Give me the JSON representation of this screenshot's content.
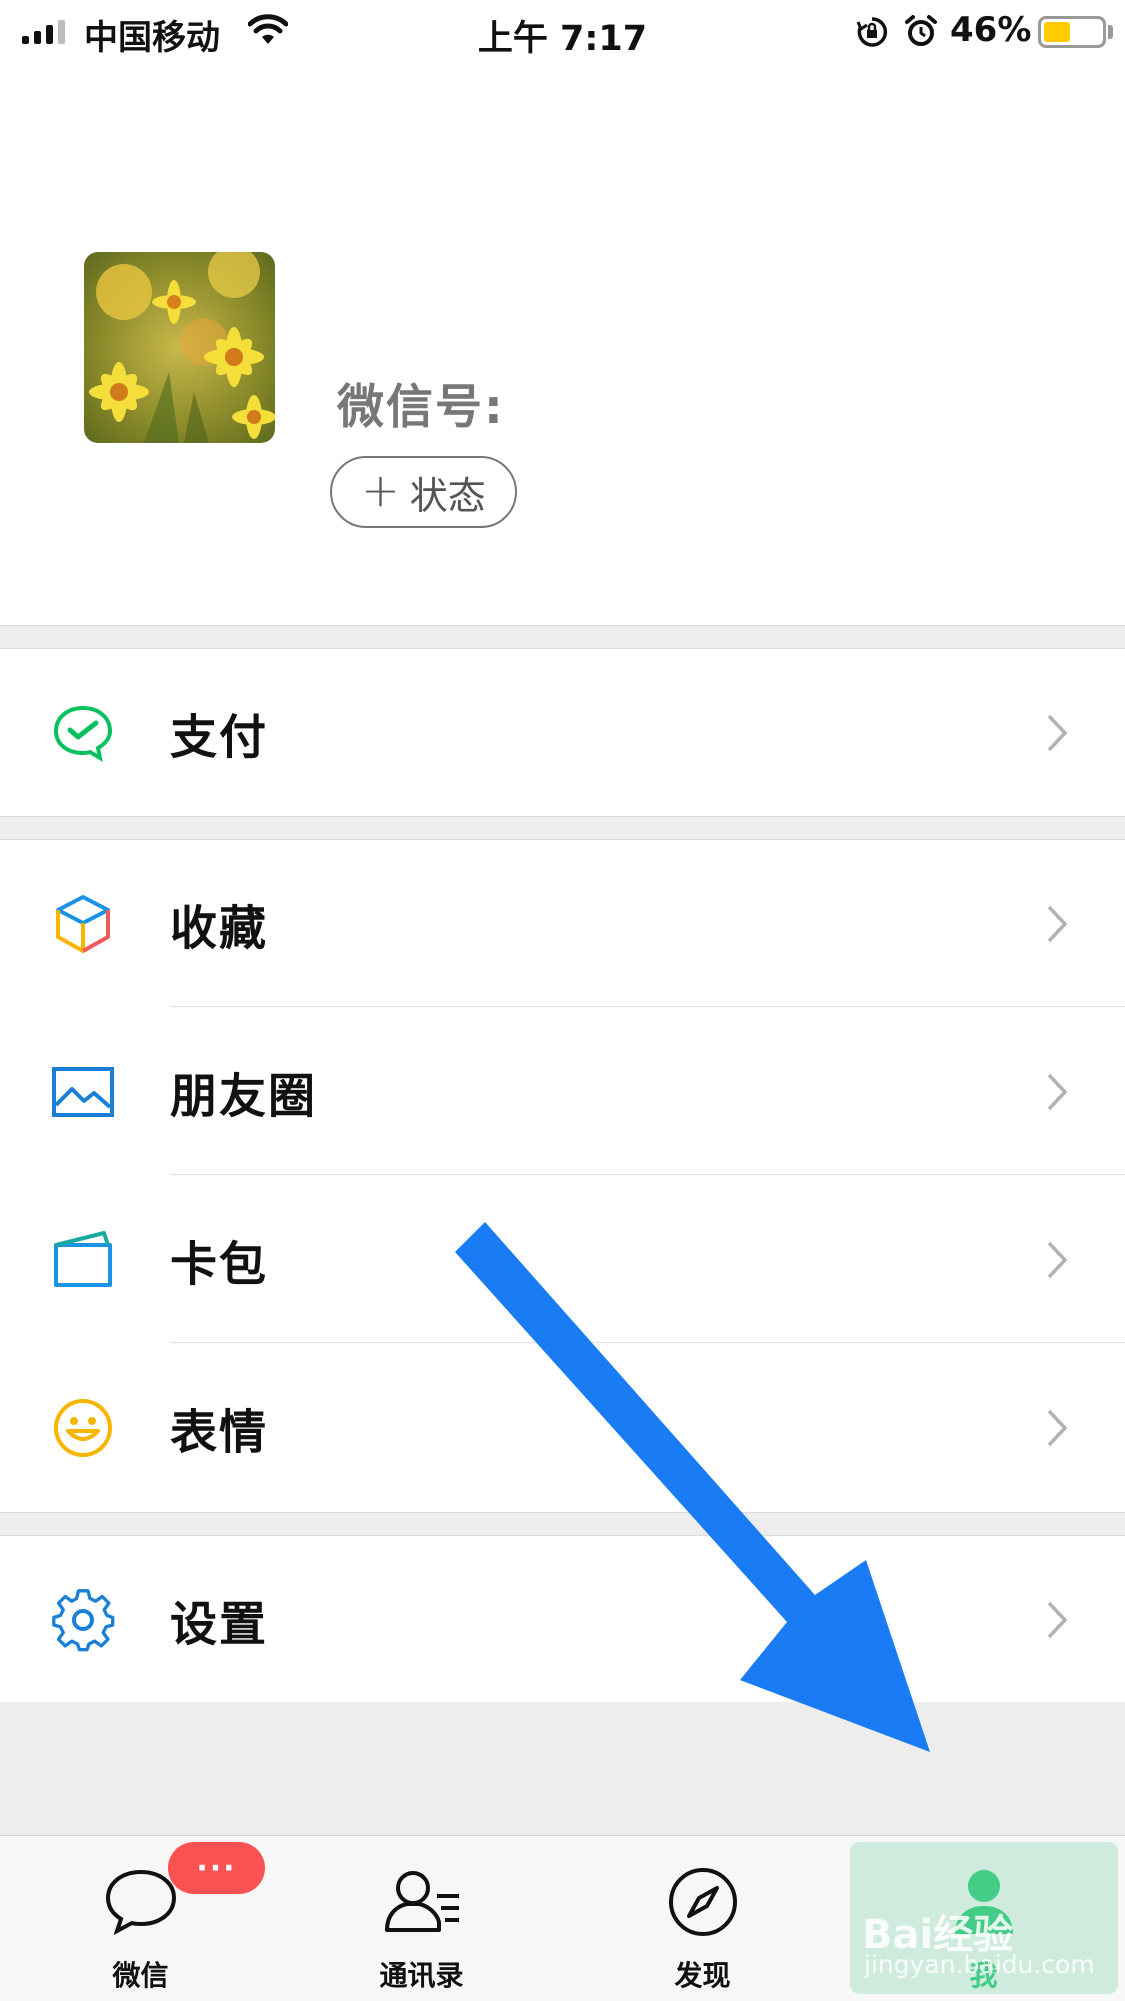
{
  "status_bar": {
    "carrier": "中国移动",
    "time": "上午 7:17",
    "battery_percent": "46%",
    "battery_level": 0.46,
    "battery_color": "#ffcc00"
  },
  "profile": {
    "wechat_id_label": "微信号:",
    "status_button_plus": "+",
    "status_button_label": "状态"
  },
  "menu": [
    {
      "label": "支付",
      "icon": "wechat-pay-icon"
    },
    {
      "label": "收藏",
      "icon": "favorites-cube-icon"
    },
    {
      "label": "朋友圈",
      "icon": "moments-picture-icon"
    },
    {
      "label": "卡包",
      "icon": "card-wallet-icon"
    },
    {
      "label": "表情",
      "icon": "smiley-icon"
    },
    {
      "label": "设置",
      "icon": "gear-icon"
    }
  ],
  "tab_bar": {
    "tabs": [
      {
        "label": "微信",
        "icon": "chat-bubble-icon",
        "badge": "···"
      },
      {
        "label": "通讯录",
        "icon": "contacts-icon"
      },
      {
        "label": "发现",
        "icon": "compass-icon"
      },
      {
        "label": "我",
        "icon": "person-icon",
        "active": true
      }
    ]
  },
  "watermark": {
    "main": "Bai经验",
    "sub": "jingyan.baidu.com"
  },
  "colors": {
    "accent_green": "#07c160",
    "badge_red": "#fa5151",
    "arrow_blue": "#1a7cf5",
    "background_gray": "#ededed"
  }
}
